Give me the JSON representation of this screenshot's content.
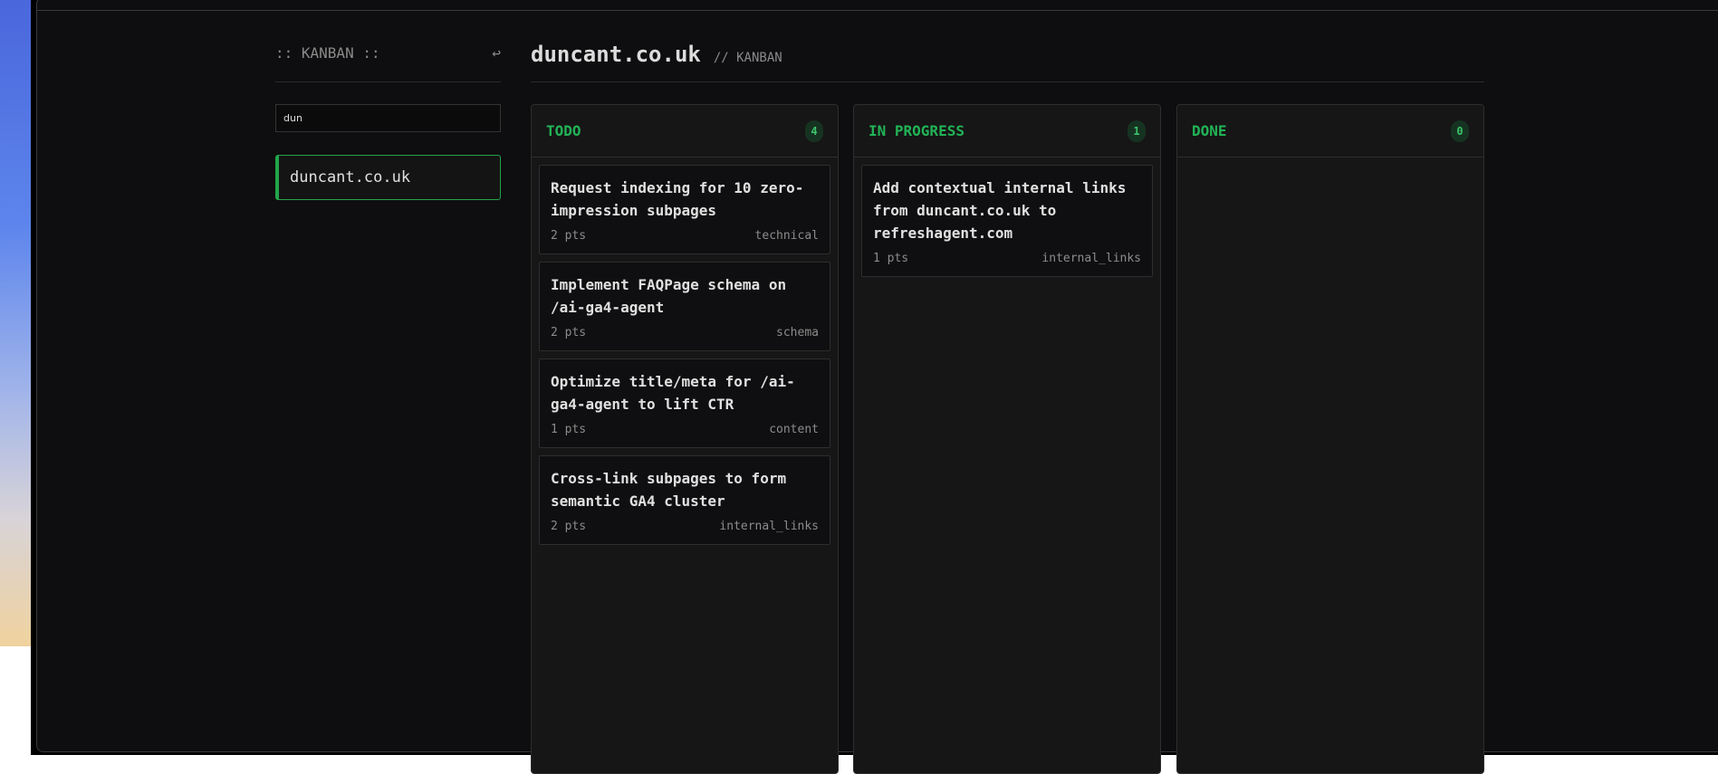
{
  "sidebar": {
    "title": ":: KANBAN ::",
    "back_icon": "return-arrow-icon",
    "search_value": "dun",
    "projects": [
      {
        "label": "duncant.co.uk"
      }
    ]
  },
  "header": {
    "title": "duncant.co.uk",
    "subtitle": "// KANBAN"
  },
  "columns": [
    {
      "title": "TODO",
      "count": "4",
      "cards": [
        {
          "title": "Request indexing for 10 zero-impression subpages",
          "points": "2 pts",
          "tag": "technical"
        },
        {
          "title": "Implement FAQPage schema on /ai-ga4-agent",
          "points": "2 pts",
          "tag": "schema"
        },
        {
          "title": "Optimize title/meta for /ai-ga4-agent to lift CTR",
          "points": "1 pts",
          "tag": "content"
        },
        {
          "title": "Cross-link subpages to form semantic GA4 cluster",
          "points": "2 pts",
          "tag": "internal_links"
        }
      ]
    },
    {
      "title": "IN PROGRESS",
      "count": "1",
      "cards": [
        {
          "title": "Add contextual internal links from duncant.co.uk to refreshagent.com",
          "points": "1 pts",
          "tag": "internal_links"
        }
      ]
    },
    {
      "title": "DONE",
      "count": "0",
      "cards": []
    }
  ],
  "colors": {
    "accent": "#22b356",
    "background": "#0e0d0f"
  }
}
